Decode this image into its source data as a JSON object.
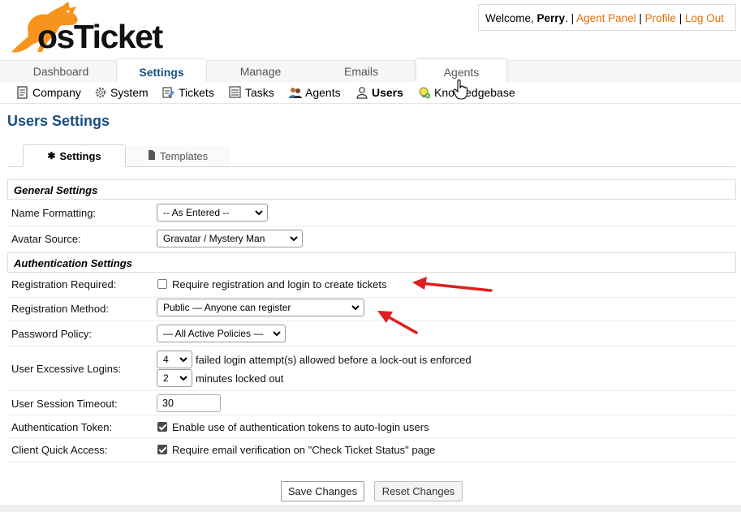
{
  "header": {
    "logo_text": "osTicket",
    "welcome_prefix": "Welcome, ",
    "user_name": "Perry",
    "period": ".",
    "sep": " | ",
    "links": [
      "Agent Panel",
      "Profile",
      "Log Out"
    ]
  },
  "nav": {
    "tabs": [
      "Dashboard",
      "Settings",
      "Manage",
      "Emails",
      "Agents"
    ],
    "active": "Settings"
  },
  "subnav": {
    "items": [
      "Company",
      "System",
      "Tickets",
      "Tasks",
      "Agents",
      "Users",
      "Knowledgebase"
    ],
    "active": "Users"
  },
  "page": {
    "title": "Users Settings",
    "tabs": [
      "Settings",
      "Templates"
    ]
  },
  "general": {
    "heading": "General Settings",
    "name_formatting_label": "Name Formatting:",
    "name_formatting_value": "-- As Entered --",
    "avatar_source_label": "Avatar Source:",
    "avatar_source_value": "Gravatar / Mystery Man"
  },
  "auth": {
    "heading": "Authentication Settings",
    "registration_required_label": "Registration Required:",
    "registration_required_text": "Require registration and login to create tickets",
    "registration_required_checked": false,
    "registration_method_label": "Registration Method:",
    "registration_method_value": "Public — Anyone can register",
    "password_policy_label": "Password Policy:",
    "password_policy_value": "— All Active Policies —",
    "excessive_logins_label": "User Excessive Logins:",
    "failed_attempts_value": "4",
    "failed_attempts_text": "failed login attempt(s) allowed before a lock-out is enforced",
    "lockout_minutes_value": "2",
    "lockout_minutes_text": "minutes locked out",
    "session_timeout_label": "User Session Timeout:",
    "session_timeout_value": "30",
    "auth_token_label": "Authentication Token:",
    "auth_token_text": "Enable use of authentication tokens to auto-login users",
    "auth_token_checked": true,
    "client_quick_access_label": "Client Quick Access:",
    "client_quick_access_text": "Require email verification on \"Check Ticket Status\" page",
    "client_quick_access_checked": true
  },
  "buttons": {
    "save": "Save Changes",
    "reset": "Reset Changes"
  },
  "colors": {
    "brand_orange": "#f7941d",
    "link_orange": "#e0700a",
    "title_blue": "#184e81",
    "annotation_red": "#e01e1e"
  }
}
